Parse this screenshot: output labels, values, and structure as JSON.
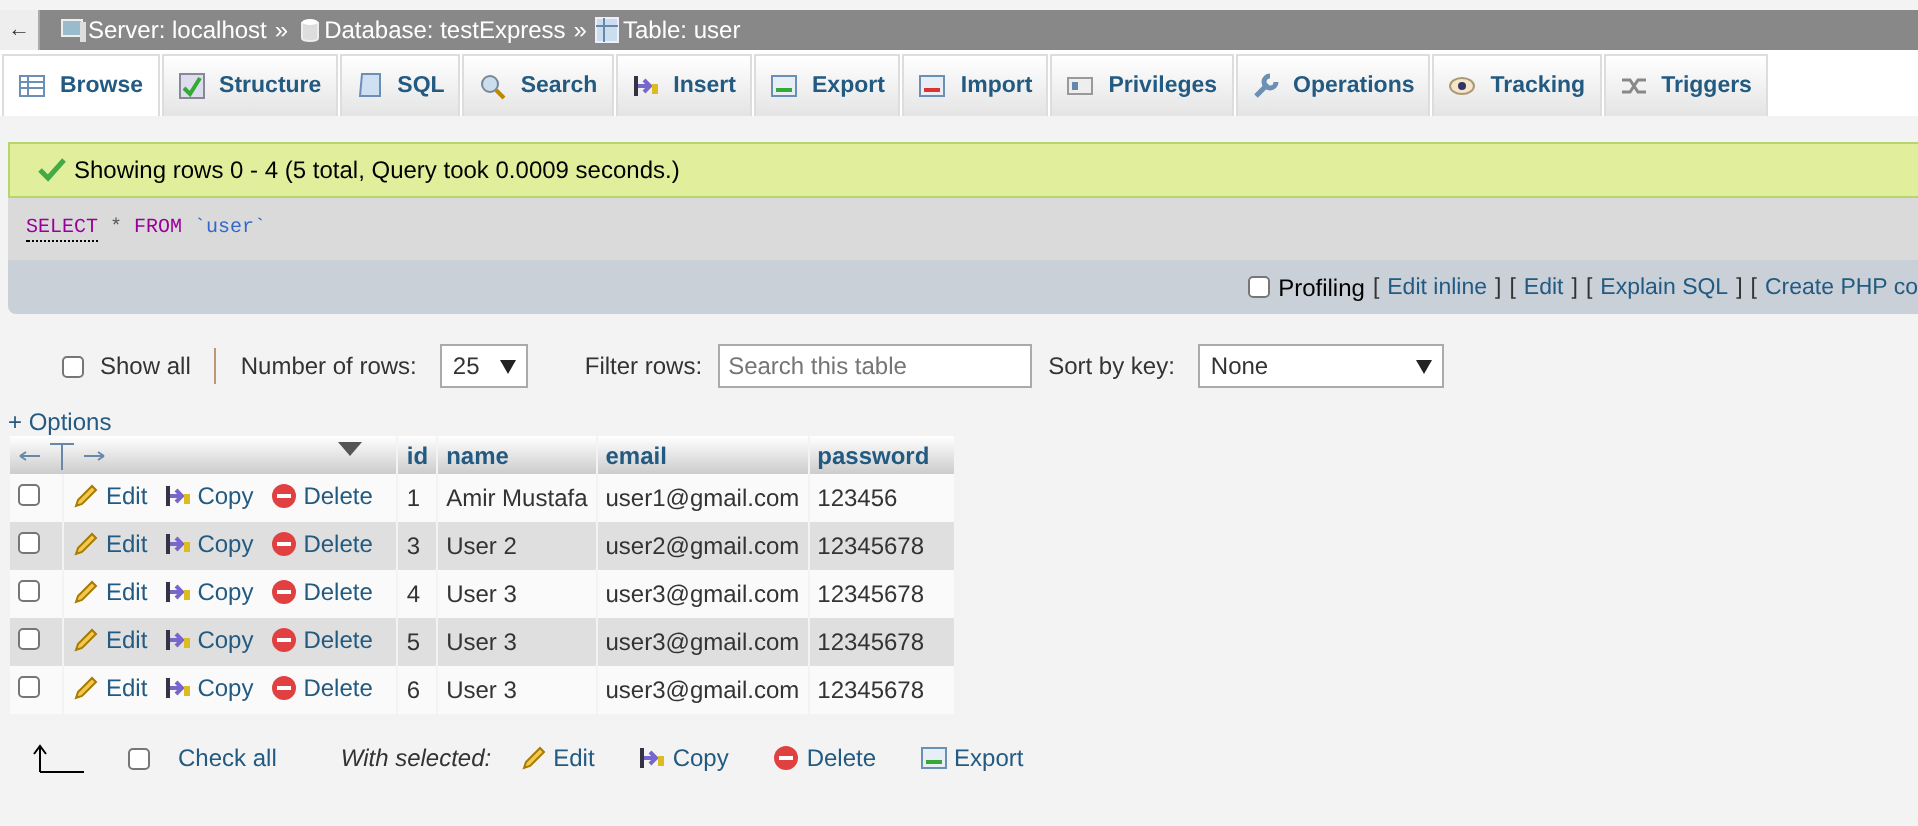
{
  "breadcrumb": {
    "back": "←",
    "items": [
      {
        "kind": "server",
        "label": "Server: localhost"
      },
      {
        "kind": "database",
        "label": "Database: testExpress"
      },
      {
        "kind": "table",
        "label": "Table: user"
      }
    ],
    "separator": "»"
  },
  "tabs": [
    {
      "kind": "browse",
      "label": "Browse",
      "selected": true
    },
    {
      "kind": "structure",
      "label": "Structure",
      "selected": false
    },
    {
      "kind": "sql",
      "label": "SQL",
      "selected": false
    },
    {
      "kind": "search",
      "label": "Search",
      "selected": false
    },
    {
      "kind": "insert",
      "label": "Insert",
      "selected": false
    },
    {
      "kind": "export",
      "label": "Export",
      "selected": false
    },
    {
      "kind": "import",
      "label": "Import",
      "selected": false
    },
    {
      "kind": "privileges",
      "label": "Privileges",
      "selected": false
    },
    {
      "kind": "operations",
      "label": "Operations",
      "selected": false
    },
    {
      "kind": "tracking",
      "label": "Tracking",
      "selected": false
    },
    {
      "kind": "triggers",
      "label": "Triggers",
      "selected": false
    }
  ],
  "message": "Showing rows 0 - 4 (5 total, Query took 0.0009 seconds.)",
  "query": {
    "keyword1": "SELECT",
    "star": "*",
    "keyword2": "FROM",
    "table": "`user`"
  },
  "query_tools": {
    "profiling": {
      "label": "Profiling",
      "checked": false
    },
    "parts": [
      {
        "kind": "text",
        "text": "["
      },
      {
        "kind": "link",
        "text": "Edit inline"
      },
      {
        "kind": "text",
        "text": "]"
      },
      {
        "kind": "text",
        "text": "["
      },
      {
        "kind": "link",
        "text": "Edit"
      },
      {
        "kind": "text",
        "text": "]"
      },
      {
        "kind": "text",
        "text": "["
      },
      {
        "kind": "link",
        "text": "Explain SQL"
      },
      {
        "kind": "text",
        "text": "]"
      },
      {
        "kind": "text",
        "text": "["
      },
      {
        "kind": "link",
        "text": "Create PHP co"
      }
    ]
  },
  "controls": {
    "show_all": {
      "label": "Show all",
      "checked": false
    },
    "rows_label": "Number of rows:",
    "rows_value": "25",
    "filter_label": "Filter rows:",
    "filter_placeholder": "Search this table",
    "sort_label": "Sort by key:",
    "sort_value": "None"
  },
  "options_link": "+ Options",
  "table": {
    "columns": [
      "id",
      "name",
      "email",
      "password"
    ],
    "rows": [
      {
        "checked": false,
        "actions": [
          "Edit",
          "Copy",
          "Delete"
        ],
        "cells": [
          "1",
          "Amir Mustafa",
          "user1@gmail.com",
          "123456"
        ]
      },
      {
        "checked": false,
        "actions": [
          "Edit",
          "Copy",
          "Delete"
        ],
        "cells": [
          "3",
          "User 2",
          "user2@gmail.com",
          "12345678"
        ]
      },
      {
        "checked": false,
        "actions": [
          "Edit",
          "Copy",
          "Delete"
        ],
        "cells": [
          "4",
          "User 3",
          "user3@gmail.com",
          "12345678"
        ]
      },
      {
        "checked": false,
        "actions": [
          "Edit",
          "Copy",
          "Delete"
        ],
        "cells": [
          "5",
          "User 3",
          "user3@gmail.com",
          "12345678"
        ]
      },
      {
        "checked": false,
        "actions": [
          "Edit",
          "Copy",
          "Delete"
        ],
        "cells": [
          "6",
          "User 3",
          "user3@gmail.com",
          "12345678"
        ]
      }
    ]
  },
  "footer": {
    "check_all": {
      "label": "Check all",
      "checked": false
    },
    "with_selected": "With selected:",
    "actions": [
      {
        "kind": "edit",
        "label": "Edit"
      },
      {
        "kind": "copy",
        "label": "Copy"
      },
      {
        "kind": "delete",
        "label": "Delete"
      },
      {
        "kind": "export",
        "label": "Export"
      }
    ]
  }
}
